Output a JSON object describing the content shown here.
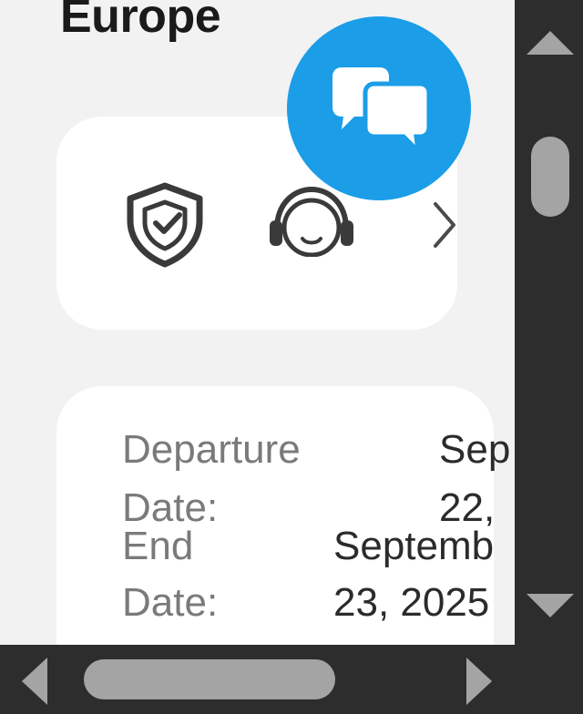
{
  "header": {
    "region": "Europe"
  },
  "services": {
    "icons": [
      "shield-check-icon",
      "customer-support-icon",
      "chevron-right-icon"
    ]
  },
  "chat": {
    "icon": "chat-bubbles-icon",
    "color": "#1b9de8"
  },
  "trip": {
    "departure_label_line1": "Departure",
    "departure_label_line2": "Date:",
    "departure_value_line1": "Sep",
    "departure_value_line2": "22,",
    "end_label_line1": "End",
    "end_label_line2": "Date:",
    "end_value_line1": "Septemb",
    "end_value_line2": "23, 2025"
  }
}
